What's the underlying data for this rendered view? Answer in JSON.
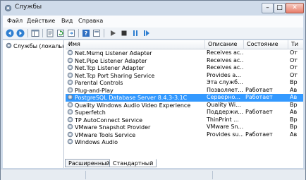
{
  "window": {
    "title": "Службы",
    "min_label": "–",
    "max_label": "□",
    "close_label": "✕"
  },
  "menu": {
    "items": [
      "Файл",
      "Действие",
      "Вид",
      "Справка"
    ]
  },
  "toolbar": {
    "icons": [
      "back-icon",
      "forward-icon",
      "console-tree-icon",
      "properties-icon",
      "refresh-icon",
      "export-icon",
      "help-icon",
      "view-icon",
      "play-icon",
      "stop-icon",
      "pause-icon",
      "restart-icon"
    ]
  },
  "left_pane": {
    "item_label": "Службы (локальные)"
  },
  "columns": {
    "name": "Имя",
    "description": "Описание",
    "state": "Состояние",
    "type": "Ти"
  },
  "services": [
    {
      "name": "Net.Msmq Listener Adapter",
      "description": "Receives ac...",
      "state": "",
      "type": "От"
    },
    {
      "name": "Net.Pipe Listener Adapter",
      "description": "Receives ac...",
      "state": "",
      "type": "От"
    },
    {
      "name": "Net.Tcp Listener Adapter",
      "description": "Receives ac...",
      "state": "",
      "type": "От"
    },
    {
      "name": "Net.Tcp Port Sharing Service",
      "description": "Provides a...",
      "state": "",
      "type": "От"
    },
    {
      "name": "Parental Controls",
      "description": "Эта служб...",
      "state": "",
      "type": "Вр"
    },
    {
      "name": "Plug-and-Play",
      "description": "Позволяет...",
      "state": "Работает",
      "type": "Ав"
    },
    {
      "name": "PostgreSQL Database Server 8.4.3-3.1C",
      "description": "Серверно...",
      "state": "Работает",
      "type": "Ав"
    },
    {
      "name": "Quality Windows Audio Video Experience",
      "description": "Quality Wi...",
      "state": "",
      "type": "Вр"
    },
    {
      "name": "Superfetch",
      "description": "Поддержи...",
      "state": "Работает",
      "type": "Ав"
    },
    {
      "name": "TP AutoConnect Service",
      "description": "ThinPrint ...",
      "state": "",
      "type": "Вр"
    },
    {
      "name": "VMware Snapshot Provider",
      "description": "VMware Sn...",
      "state": "",
      "type": "Вр"
    },
    {
      "name": "VMware Tools Service",
      "description": "Provides su...",
      "state": "Работает",
      "type": "Ав"
    },
    {
      "name": "Windows Audio",
      "description": "",
      "state": "",
      "type": ""
    }
  ],
  "selected_index": 6,
  "tabs": {
    "extended": "Расширенный",
    "standard": "Стандартный"
  },
  "colors": {
    "selection": "#3399ff",
    "window_frame": "#cfdbea"
  }
}
